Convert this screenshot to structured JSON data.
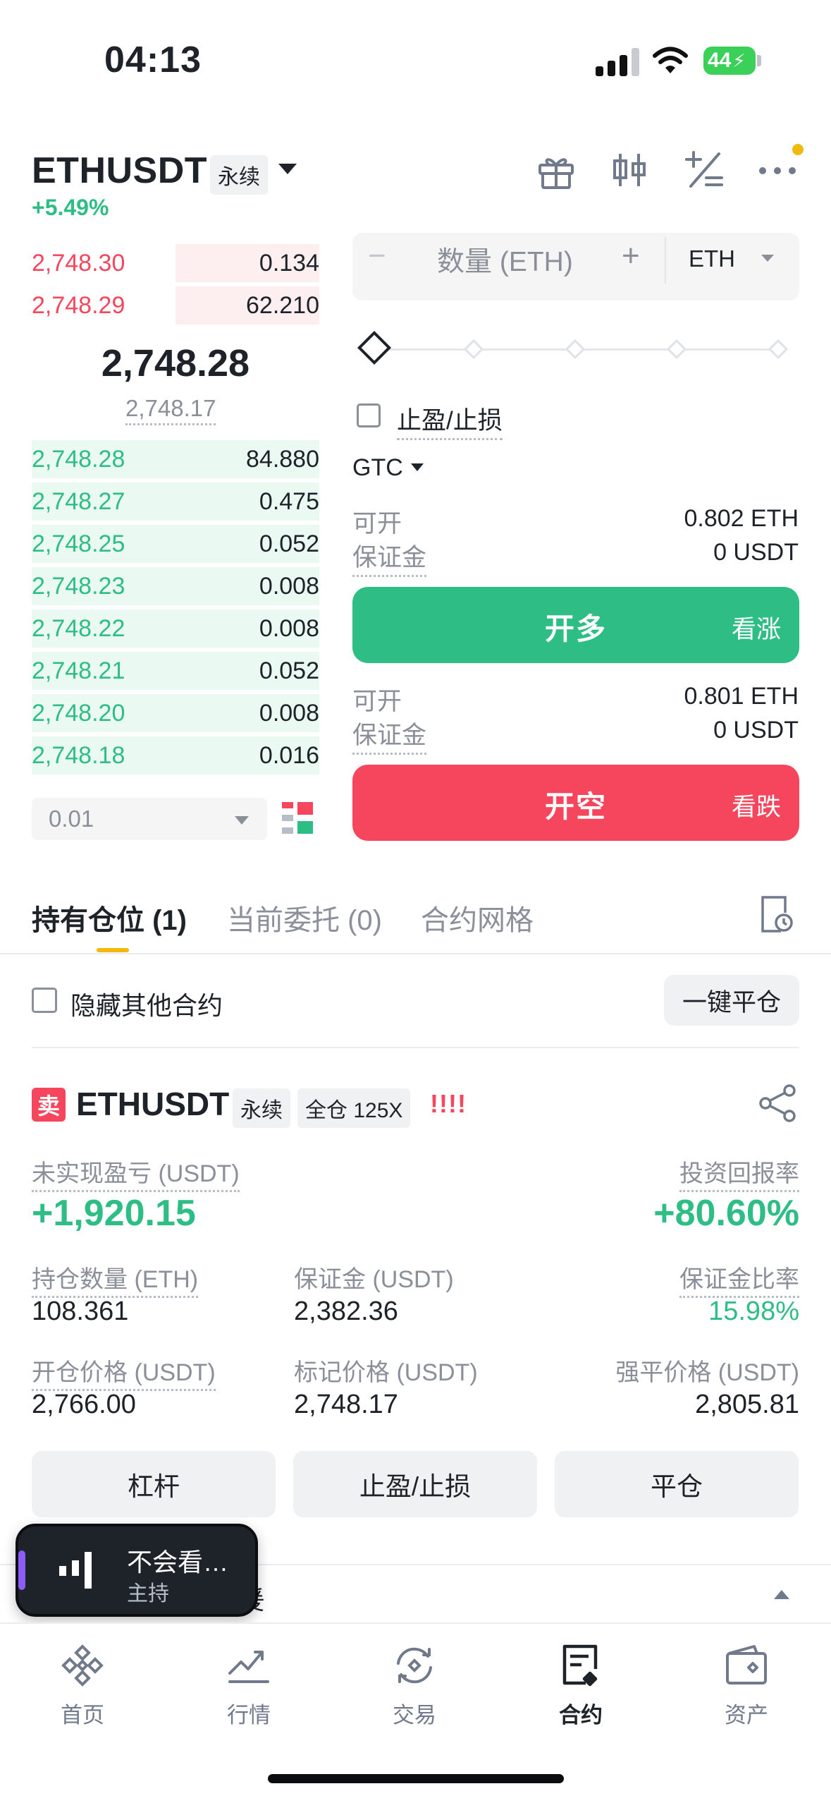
{
  "status_bar": {
    "time": "04:13",
    "battery": "44"
  },
  "header": {
    "symbol": "ETHUSDT",
    "contract_type": "永续",
    "change": "+5.49%",
    "icons": [
      "gift-icon",
      "candlestick-icon",
      "calculator-icon",
      "more-icon"
    ]
  },
  "order_book": {
    "asks": [
      {
        "price": "2,748.30",
        "qty": "0.134"
      },
      {
        "price": "2,748.29",
        "qty": "62.210"
      }
    ],
    "last_price": "2,748.28",
    "mark_price": "2,748.17",
    "bids": [
      {
        "price": "2,748.28",
        "qty": "84.880"
      },
      {
        "price": "2,748.27",
        "qty": "0.475"
      },
      {
        "price": "2,748.25",
        "qty": "0.052"
      },
      {
        "price": "2,748.23",
        "qty": "0.008"
      },
      {
        "price": "2,748.22",
        "qty": "0.008"
      },
      {
        "price": "2,748.21",
        "qty": "0.052"
      },
      {
        "price": "2,748.20",
        "qty": "0.008"
      },
      {
        "price": "2,748.18",
        "qty": "0.016"
      }
    ],
    "depth_step": "0.01"
  },
  "order_form": {
    "qty_minus": "−",
    "qty_placeholder": "数量 (ETH)",
    "qty_plus": "+",
    "unit": "ETH",
    "slider_percent": 0,
    "tpsl_label": "止盈/止损",
    "time_in_force": "GTC",
    "long": {
      "avail_label": "可开",
      "avail_value": "0.802 ETH",
      "margin_label": "保证金",
      "margin_value": "0 USDT",
      "button": "开多",
      "button_sub": "看涨"
    },
    "short": {
      "avail_label": "可开",
      "avail_value": "0.801 ETH",
      "margin_label": "保证金",
      "margin_value": "0 USDT",
      "button": "开空",
      "button_sub": "看跌"
    }
  },
  "positions_tabs": {
    "tabs": [
      "持有仓位 (1)",
      "当前委托 (0)",
      "合约网格"
    ],
    "active": 0,
    "hide_other_label": "隐藏其他合约",
    "close_all_label": "一键平仓"
  },
  "position": {
    "side": "卖",
    "symbol": "ETHUSDT",
    "contract_type": "永续",
    "margin_mode": "全仓 125X",
    "risk_indicator": "!!!!",
    "pnl_label": "未实现盈亏 (USDT)",
    "pnl_value": "+1,920.15",
    "roe_label": "投资回报率",
    "roe_value": "+80.60%",
    "size_label": "持仓数量 (ETH)",
    "size_value": "108.361",
    "margin_label": "保证金 (USDT)",
    "margin_value": "2,382.36",
    "margin_ratio_label": "保证金比率",
    "margin_ratio_value": "15.98%",
    "entry_label": "开仓价格 (USDT)",
    "entry_value": "2,766.00",
    "mark_label": "标记价格 (USDT)",
    "mark_value": "2,748.17",
    "liq_label": "强平价格 (USDT)",
    "liq_value": "2,805.81",
    "buttons": [
      "杠杆",
      "止盈/止损",
      "平仓"
    ]
  },
  "collapsed_section": {
    "text_fragment": "爰"
  },
  "live_pill": {
    "title": "不会看…",
    "subtitle": "主持"
  },
  "bottom_nav": {
    "items": [
      "首页",
      "行情",
      "交易",
      "合约",
      "资产"
    ],
    "active": 3
  },
  "colors": {
    "green": "#2ebd85",
    "red": "#f6465d",
    "accent": "#f0b90b"
  }
}
